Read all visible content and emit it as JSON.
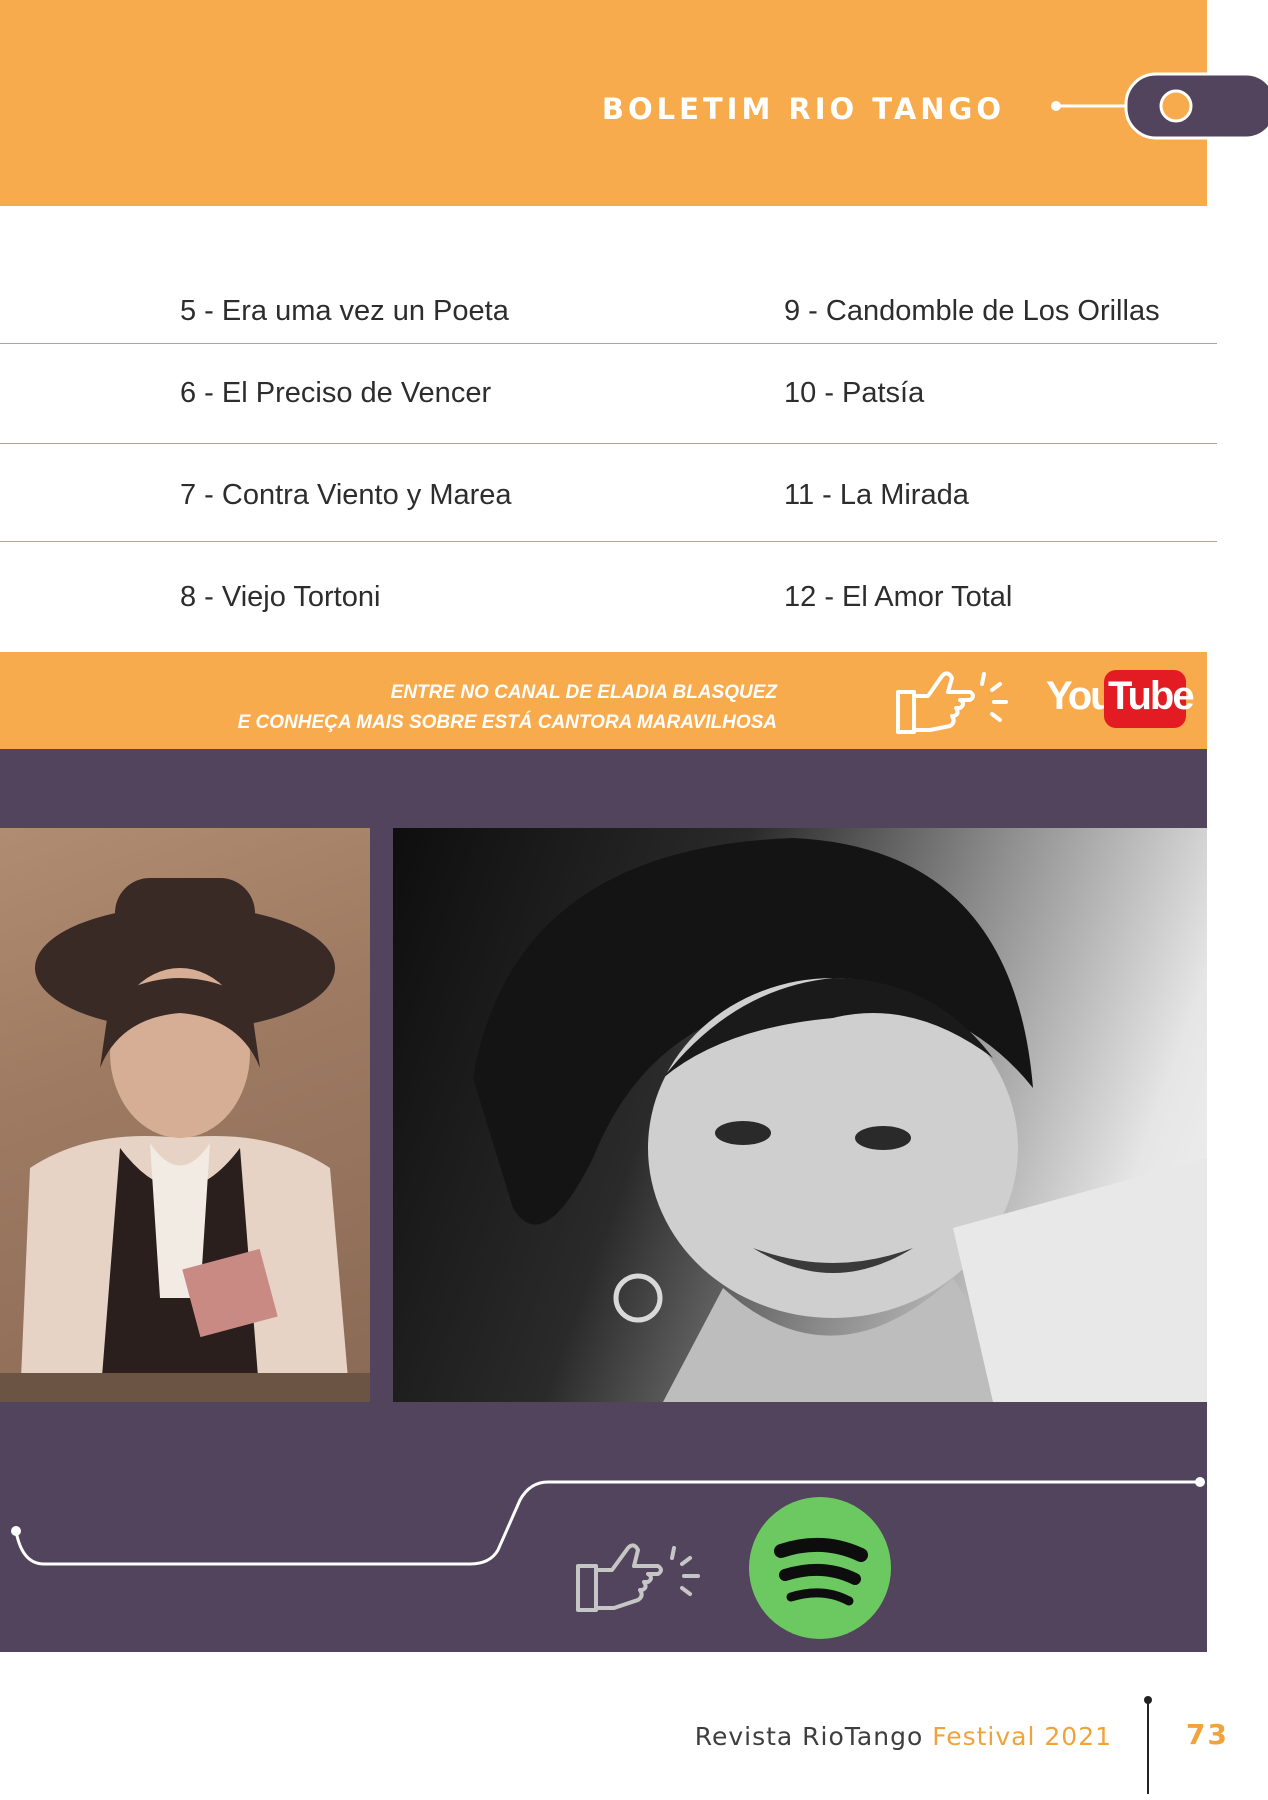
{
  "header": {
    "title": "BOLETIM RIO TANGO",
    "band_color": "#f8ab4d",
    "accent_color": "#52445c"
  },
  "tracklist": [
    {
      "left": "5 - Era uma vez un Poeta",
      "right": "9 - Candomble de Los Orillas"
    },
    {
      "left": "6 - El Preciso de Vencer",
      "right": "10 - Patsía"
    },
    {
      "left": "7 - Contra Viento y Marea",
      "right": "11 - La Mirada"
    },
    {
      "left": "8 - Viejo Tortoni",
      "right": "12 - El Amor Total"
    }
  ],
  "youtube_cta": {
    "line1": "ENTRE NO CANAL DE ELADIA BLASQUEZ",
    "line2": "E CONHEÇA MAIS SOBRE ESTÁ CANTORA MARAVILHOSA",
    "logo_you": "You",
    "logo_tube": "Tube",
    "hand_icon": "pointing-hand-icon",
    "logo_icon": "youtube-logo"
  },
  "photos": {
    "left": "vintage-sepia-portrait",
    "right": "black-and-white-portrait"
  },
  "spotify": {
    "icon": "spotify-icon",
    "hand_icon": "pointing-hand-icon",
    "color": "#6cc860"
  },
  "footer": {
    "magazine": "Revista RioTango",
    "edition": "Festival 2021",
    "page_number": "73"
  }
}
